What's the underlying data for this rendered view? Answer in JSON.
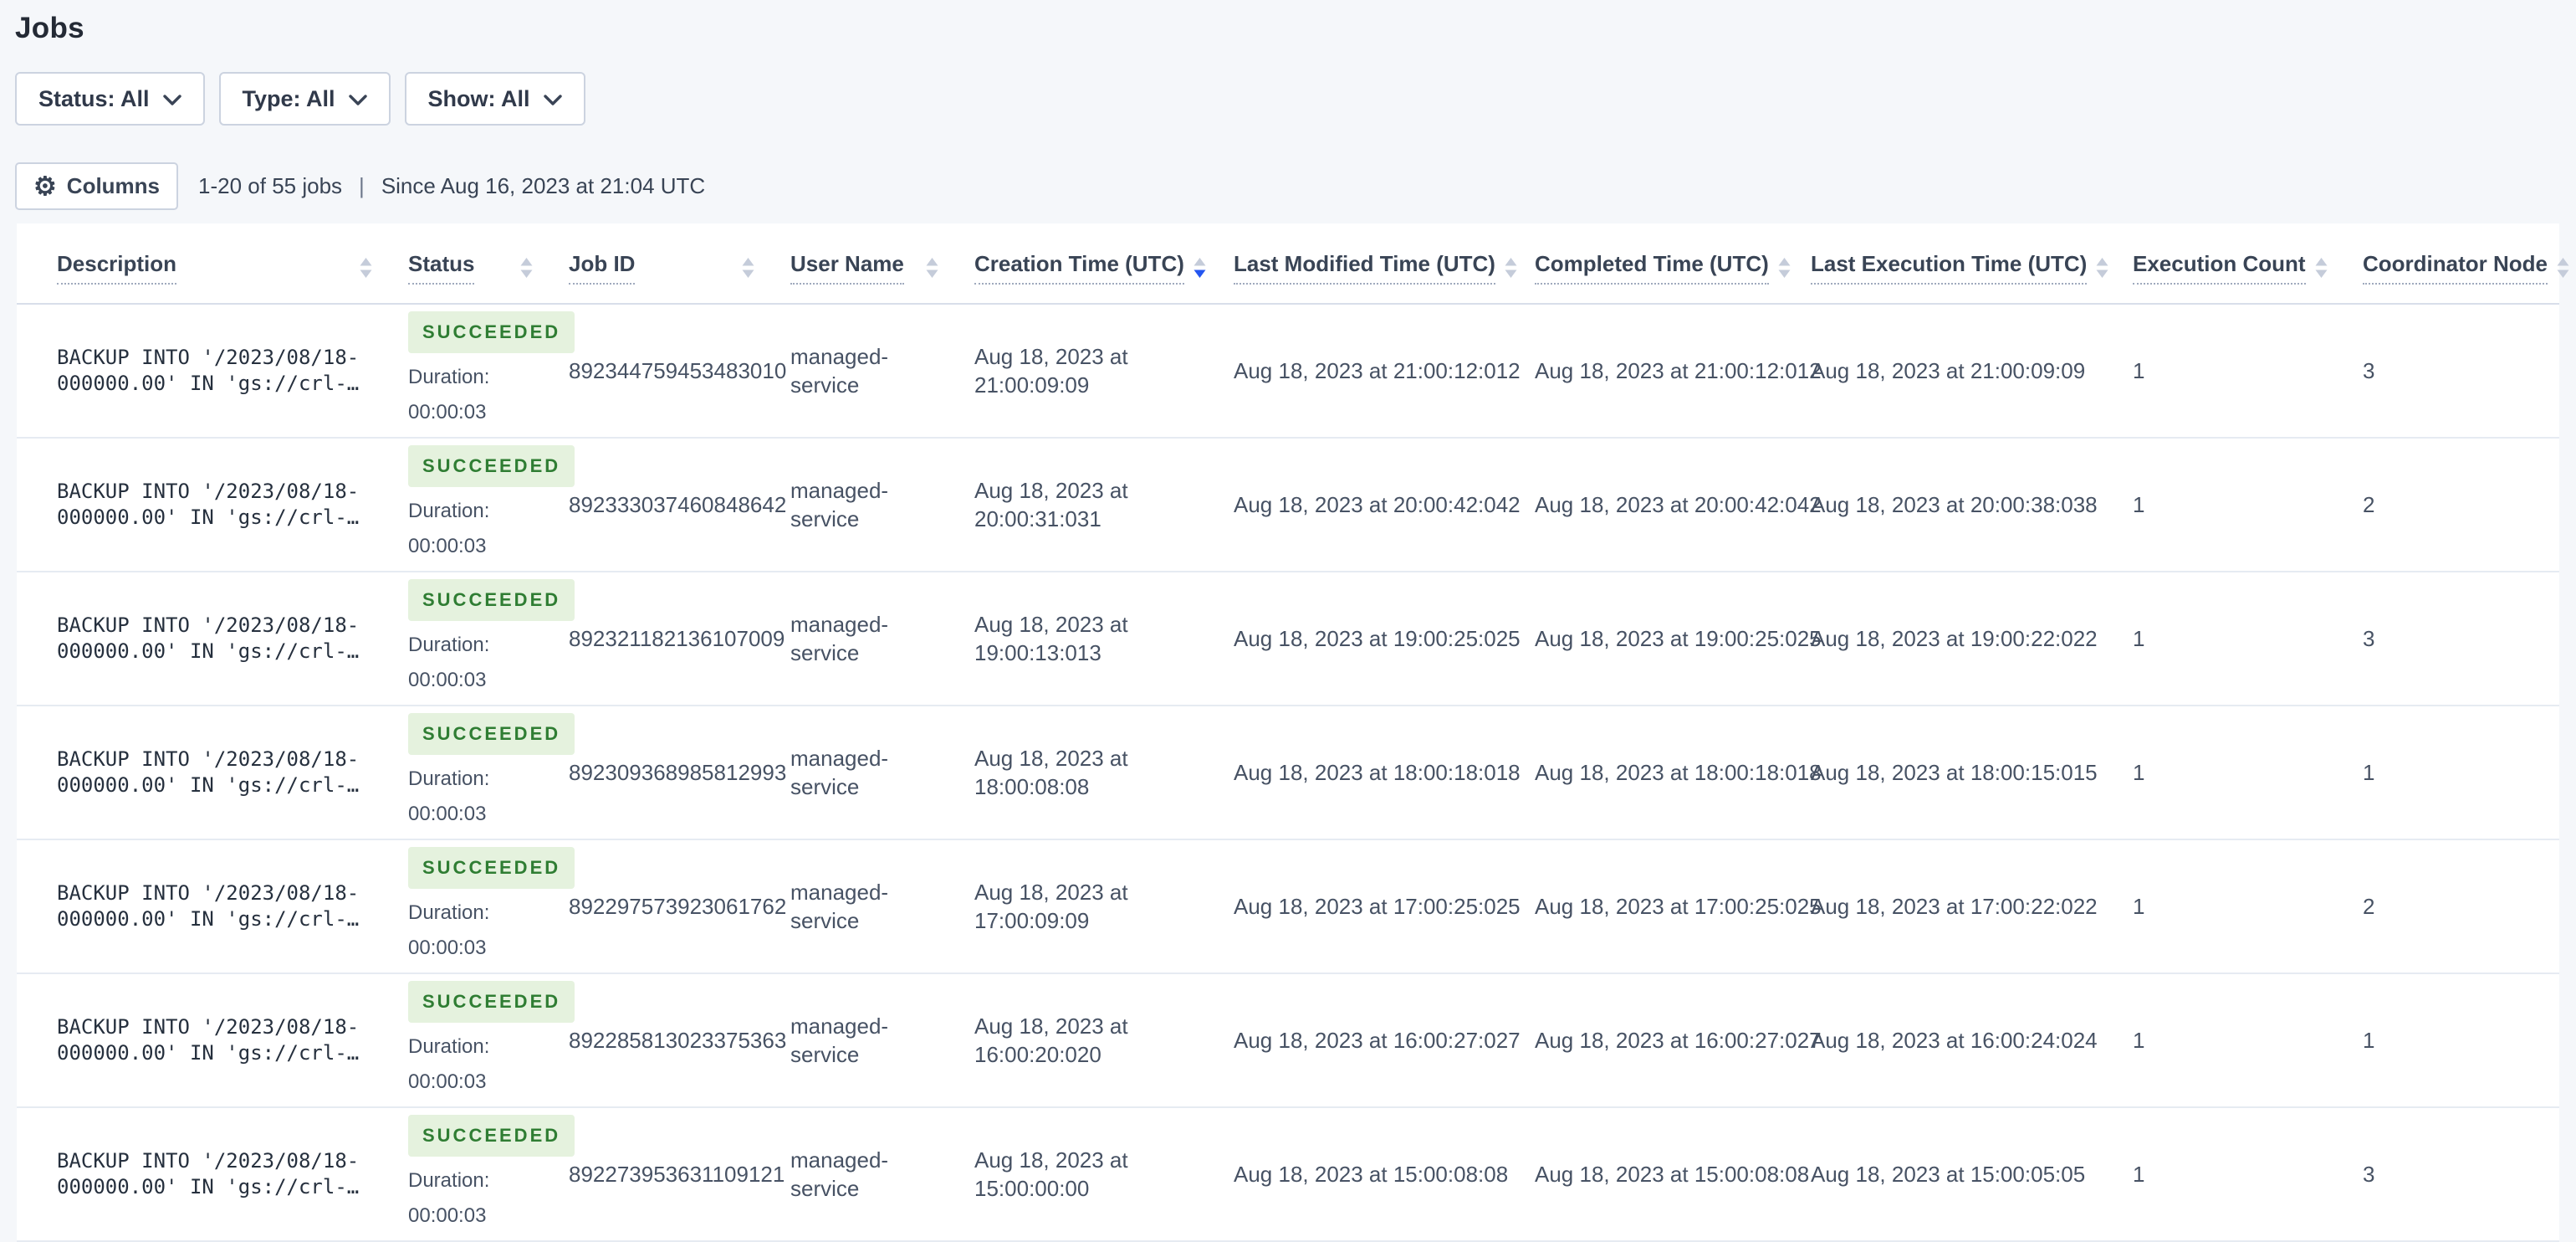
{
  "page_title": "Jobs",
  "filters": {
    "status": "Status: All",
    "type": "Type: All",
    "show": "Show: All"
  },
  "toolbar": {
    "columns_button": "Columns",
    "results_count": "1-20 of 55 jobs",
    "separator": "|",
    "since": "Since Aug 16, 2023 at 21:04 UTC"
  },
  "icons": {
    "gear": "gear-icon",
    "chevron_down": "chevron-down-icon",
    "sort": "sort-arrows-icon"
  },
  "colors": {
    "page_bg": "#f5f7fa",
    "panel_bg": "#ffffff",
    "header_text": "#394455",
    "body_text": "#475264",
    "sort_active": "#2456f0",
    "success_text": "#2f7d33",
    "success_bg": "#e5f2de"
  },
  "table": {
    "columns": [
      {
        "label": "Description",
        "sort": "none"
      },
      {
        "label": "Status",
        "sort": "none"
      },
      {
        "label": "Job ID",
        "sort": "none"
      },
      {
        "label": "User Name",
        "sort": "none"
      },
      {
        "label": "Creation Time (UTC)",
        "sort": "desc"
      },
      {
        "label": "Last Modified Time (UTC)",
        "sort": "none"
      },
      {
        "label": "Completed Time (UTC)",
        "sort": "none"
      },
      {
        "label": "Last Execution Time (UTC)",
        "sort": "none"
      },
      {
        "label": "Execution Count",
        "sort": "none"
      },
      {
        "label": "Coordinator Node",
        "sort": "none"
      }
    ],
    "rows": [
      {
        "description": "BACKUP INTO '/2023/08/18-000000.00' IN 'gs://crl-…",
        "status": "SUCCEEDED",
        "duration": "Duration: 00:00:03",
        "job_id": "892344759453483010",
        "user_name": "managed-service",
        "creation_time": "Aug 18, 2023 at 21:00:09:09",
        "last_modified_time": "Aug 18, 2023 at 21:00:12:012",
        "completed_time": "Aug 18, 2023 at 21:00:12:012",
        "last_execution_time": "Aug 18, 2023 at 21:00:09:09",
        "execution_count": "1",
        "coordinator_node": "3"
      },
      {
        "description": "BACKUP INTO '/2023/08/18-000000.00' IN 'gs://crl-…",
        "status": "SUCCEEDED",
        "duration": "Duration: 00:00:03",
        "job_id": "892333037460848642",
        "user_name": "managed-service",
        "creation_time": "Aug 18, 2023 at 20:00:31:031",
        "last_modified_time": "Aug 18, 2023 at 20:00:42:042",
        "completed_time": "Aug 18, 2023 at 20:00:42:042",
        "last_execution_time": "Aug 18, 2023 at 20:00:38:038",
        "execution_count": "1",
        "coordinator_node": "2"
      },
      {
        "description": "BACKUP INTO '/2023/08/18-000000.00' IN 'gs://crl-…",
        "status": "SUCCEEDED",
        "duration": "Duration: 00:00:03",
        "job_id": "892321182136107009",
        "user_name": "managed-service",
        "creation_time": "Aug 18, 2023 at 19:00:13:013",
        "last_modified_time": "Aug 18, 2023 at 19:00:25:025",
        "completed_time": "Aug 18, 2023 at 19:00:25:025",
        "last_execution_time": "Aug 18, 2023 at 19:00:22:022",
        "execution_count": "1",
        "coordinator_node": "3"
      },
      {
        "description": "BACKUP INTO '/2023/08/18-000000.00' IN 'gs://crl-…",
        "status": "SUCCEEDED",
        "duration": "Duration: 00:00:03",
        "job_id": "892309368985812993",
        "user_name": "managed-service",
        "creation_time": "Aug 18, 2023 at 18:00:08:08",
        "last_modified_time": "Aug 18, 2023 at 18:00:18:018",
        "completed_time": "Aug 18, 2023 at 18:00:18:018",
        "last_execution_time": "Aug 18, 2023 at 18:00:15:015",
        "execution_count": "1",
        "coordinator_node": "1"
      },
      {
        "description": "BACKUP INTO '/2023/08/18-000000.00' IN 'gs://crl-…",
        "status": "SUCCEEDED",
        "duration": "Duration: 00:00:03",
        "job_id": "892297573923061762",
        "user_name": "managed-service",
        "creation_time": "Aug 18, 2023 at 17:00:09:09",
        "last_modified_time": "Aug 18, 2023 at 17:00:25:025",
        "completed_time": "Aug 18, 2023 at 17:00:25:025",
        "last_execution_time": "Aug 18, 2023 at 17:00:22:022",
        "execution_count": "1",
        "coordinator_node": "2"
      },
      {
        "description": "BACKUP INTO '/2023/08/18-000000.00' IN 'gs://crl-…",
        "status": "SUCCEEDED",
        "duration": "Duration: 00:00:03",
        "job_id": "892285813023375363",
        "user_name": "managed-service",
        "creation_time": "Aug 18, 2023 at 16:00:20:020",
        "last_modified_time": "Aug 18, 2023 at 16:00:27:027",
        "completed_time": "Aug 18, 2023 at 16:00:27:027",
        "last_execution_time": "Aug 18, 2023 at 16:00:24:024",
        "execution_count": "1",
        "coordinator_node": "1"
      },
      {
        "description": "BACKUP INTO '/2023/08/18-000000.00' IN 'gs://crl-…",
        "status": "SUCCEEDED",
        "duration": "Duration: 00:00:03",
        "job_id": "892273953631109121",
        "user_name": "managed-service",
        "creation_time": "Aug 18, 2023 at 15:00:00:00",
        "last_modified_time": "Aug 18, 2023 at 15:00:08:08",
        "completed_time": "Aug 18, 2023 at 15:00:08:08",
        "last_execution_time": "Aug 18, 2023 at 15:00:05:05",
        "execution_count": "1",
        "coordinator_node": "3"
      }
    ]
  }
}
